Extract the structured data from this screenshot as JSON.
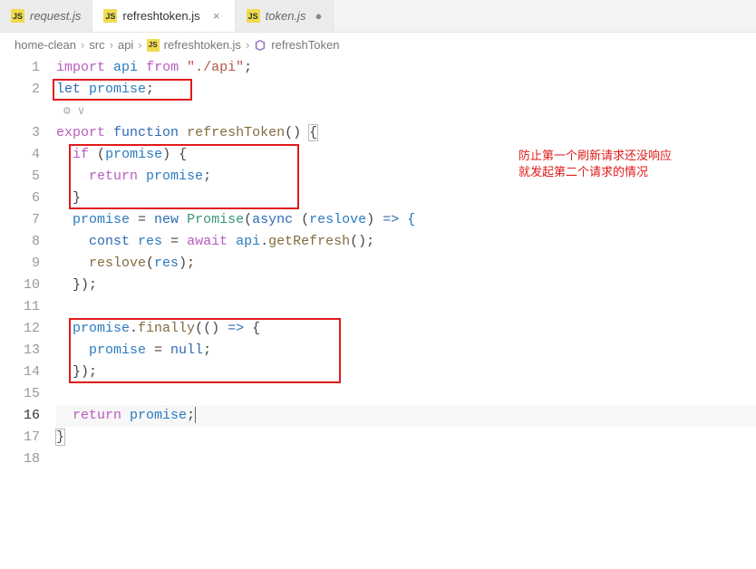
{
  "tabs": [
    {
      "label": "request.js",
      "icon": "JS",
      "active": false,
      "dirty": false
    },
    {
      "label": "refreshtoken.js",
      "icon": "JS",
      "active": true,
      "dirty": false
    },
    {
      "label": "token.js",
      "icon": "JS",
      "active": false,
      "dirty": true
    }
  ],
  "breadcrumbs": {
    "root": "home-clean",
    "seg1": "src",
    "seg2": "api",
    "file_icon": "JS",
    "file": "refreshtoken.js",
    "symbol": "refreshToken"
  },
  "line_numbers": [
    "1",
    "2",
    "3",
    "4",
    "5",
    "6",
    "7",
    "8",
    "9",
    "10",
    "11",
    "12",
    "13",
    "14",
    "15",
    "16",
    "17",
    "18"
  ],
  "current_line": "16",
  "code": {
    "l1": {
      "kw1": "import",
      "id": "api",
      "kw2": "from",
      "str": "\"./api\"",
      "semi": ";"
    },
    "l2": {
      "kw": "let",
      "id": "promise",
      "semi": ";"
    },
    "l3": {
      "kw1": "export",
      "kw2": "function",
      "fn": "refreshToken",
      "paren": "()",
      "sp": " ",
      "brace": "{"
    },
    "l4": {
      "indent": "  ",
      "kw": "if",
      "sp": " ",
      "open": "(",
      "id": "promise",
      "close": ") {"
    },
    "l5": {
      "indent": "    ",
      "kw": "return",
      "sp": " ",
      "id": "promise",
      "semi": ";"
    },
    "l6": {
      "indent": "  ",
      "brace": "}"
    },
    "l7": {
      "indent": "  ",
      "id": "promise",
      "eq": " = ",
      "kw": "new",
      "sp": " ",
      "cls": "Promise",
      "open": "(",
      "async": "async",
      "sp2": " ",
      "p1": "(",
      "param": "reslove",
      "p2": ")",
      "arrow": " => {"
    },
    "l8": {
      "indent": "    ",
      "kw": "const",
      "sp": " ",
      "id": "res",
      "eq": " = ",
      "kw2": "await",
      "sp2": " ",
      "obj": "api",
      "dot": ".",
      "fn": "getRefresh",
      "call": "();"
    },
    "l9": {
      "indent": "    ",
      "fn": "reslove",
      "open": "(",
      "id": "res",
      "close": ");"
    },
    "l10": {
      "indent": "  ",
      "close": "});"
    },
    "l12": {
      "indent": "  ",
      "id": "promise",
      "dot": ".",
      "fn": "finally",
      "open": "(() ",
      "arrow": "=>",
      "brace": " {"
    },
    "l13": {
      "indent": "    ",
      "id": "promise",
      "eq": " = ",
      "null": "null",
      "semi": ";"
    },
    "l14": {
      "indent": "  ",
      "close": "});"
    },
    "l16": {
      "indent": "  ",
      "kw": "return",
      "sp": " ",
      "id": "promise",
      "semi": ";"
    },
    "l17": {
      "brace": "}"
    }
  },
  "annotation": {
    "line1": "防止第一个刷新请求还没响应",
    "line2": "就发起第二个请求的情况"
  }
}
